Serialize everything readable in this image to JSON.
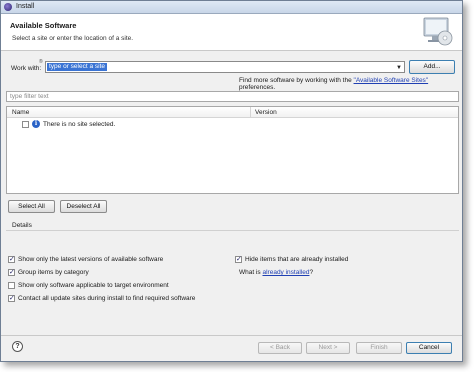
{
  "window": {
    "title": "Install"
  },
  "header": {
    "title": "Available Software",
    "description": "Select a site or enter the location of a site."
  },
  "work_with": {
    "label": "Work with:",
    "help_marker": "®",
    "value": "type or select a site",
    "add_button": "Add..."
  },
  "more_software": {
    "prefix": "Find more software by working with the ",
    "link": "\"Available Software Sites\"",
    "suffix": " preferences."
  },
  "filter": {
    "placeholder": "type filter text"
  },
  "table": {
    "columns": [
      "Name",
      "Version"
    ],
    "rows": [
      {
        "text": "There is no site selected."
      }
    ]
  },
  "selection_buttons": {
    "select_all": "Select All",
    "deselect_all": "Deselect All"
  },
  "details": {
    "label": "Details"
  },
  "options": {
    "latest_versions": {
      "label": "Show only the latest versions of available software",
      "checked": true
    },
    "group_by_category": {
      "label": "Group items by category",
      "checked": true
    },
    "applicable_only": {
      "label": "Show only software applicable to target environment",
      "checked": false
    },
    "contact_sites": {
      "label": "Contact all update sites during install to find required software",
      "checked": true
    },
    "hide_installed": {
      "label": "Hide items that are already installed",
      "checked": true
    },
    "what_is": {
      "prefix": "What is ",
      "link": "already installed",
      "suffix": "?"
    }
  },
  "footer": {
    "help": "?",
    "back": "< Back",
    "next": "Next >",
    "finish": "Finish",
    "cancel": "Cancel"
  }
}
